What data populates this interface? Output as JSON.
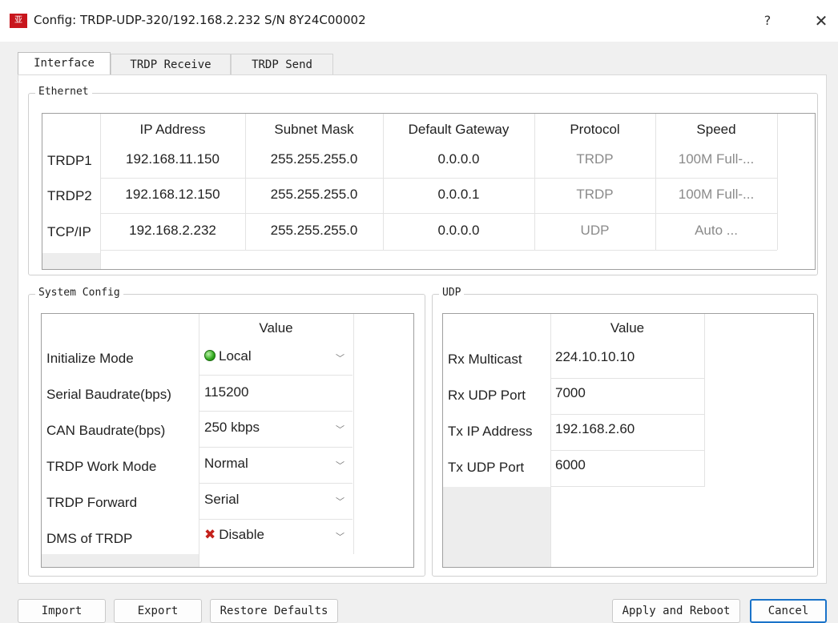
{
  "window": {
    "app_icon_text": "亚",
    "title": "Config: TRDP-UDP-320/192.168.2.232  S/N 8Y24C00002",
    "help": "?",
    "close": "✕"
  },
  "tabs": [
    {
      "label": "Interface",
      "active": true
    },
    {
      "label": "TRDP Receive",
      "active": false
    },
    {
      "label": "TRDP Send",
      "active": false
    }
  ],
  "ethernet": {
    "title": "Ethernet",
    "columns": [
      "IP Address",
      "Subnet Mask",
      "Default Gateway",
      "Protocol",
      "Speed"
    ],
    "rows": [
      {
        "name": "TRDP1",
        "ip": "192.168.11.150",
        "mask": "255.255.255.0",
        "gateway": "0.0.0.0",
        "protocol": "TRDP",
        "speed": "100M Full-..."
      },
      {
        "name": "TRDP2",
        "ip": "192.168.12.150",
        "mask": "255.255.255.0",
        "gateway": "0.0.0.1",
        "protocol": "TRDP",
        "speed": "100M Full-..."
      },
      {
        "name": "TCP/IP",
        "ip": "192.168.2.232",
        "mask": "255.255.255.0",
        "gateway": "0.0.0.0",
        "protocol": "UDP",
        "speed": "Auto ..."
      }
    ]
  },
  "system_config": {
    "title": "System Config",
    "value_header": "Value",
    "rows": [
      {
        "label": "Initialize Mode",
        "value": "Local",
        "icon": "green-led-icon",
        "combo": true
      },
      {
        "label": "Serial Baudrate(bps)",
        "value": "115200",
        "combo": false
      },
      {
        "label": "CAN Baudrate(bps)",
        "value": "250 kbps",
        "combo": true
      },
      {
        "label": "TRDP Work Mode",
        "value": "Normal",
        "combo": true
      },
      {
        "label": "TRDP Forward",
        "value": "Serial",
        "combo": true
      },
      {
        "label": "DMS of TRDP",
        "value": "Disable",
        "icon": "red-x-icon",
        "combo": true
      }
    ]
  },
  "udp": {
    "title": "UDP",
    "value_header": "Value",
    "rows": [
      {
        "label": "Rx Multicast",
        "value": "224.10.10.10"
      },
      {
        "label": "Rx UDP Port",
        "value": "7000"
      },
      {
        "label": "Tx IP Address",
        "value": "192.168.2.60"
      },
      {
        "label": "Tx UDP Port",
        "value": "6000"
      }
    ]
  },
  "buttons": {
    "import": "Import",
    "export": "Export",
    "restore": "Restore Defaults",
    "apply": "Apply and Reboot",
    "cancel": "Cancel"
  },
  "colors": {
    "accent": "#1a73c9",
    "led_green": "#2fa81c",
    "disable_red": "#c4211b",
    "brand_red": "#c8161d"
  }
}
